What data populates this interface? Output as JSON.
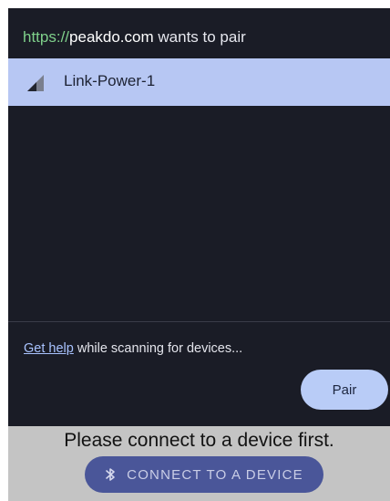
{
  "dialog": {
    "origin_scheme": "https://",
    "origin_host": "peakdo.com",
    "origin_suffix": " wants to pair",
    "devices": [
      {
        "name": "Link-Power-1",
        "icon": "signal-strength-icon",
        "selected": true
      }
    ],
    "help_link_label": "Get help",
    "help_suffix": " while scanning for devices...",
    "pair_label": "Pair"
  },
  "page": {
    "prompt": "Please connect to a device first.",
    "connect_label": "CONNECT TO A DEVICE",
    "connect_icon": "bluetooth-icon"
  },
  "colors": {
    "dialog_bg": "#1a1c26",
    "selected_item_bg": "#b7c7f3",
    "pair_button_bg": "#b9ccf7",
    "scheme_green": "#7fd08b",
    "connect_button_bg": "#4a5699",
    "backdrop": "#c4c4c4"
  }
}
